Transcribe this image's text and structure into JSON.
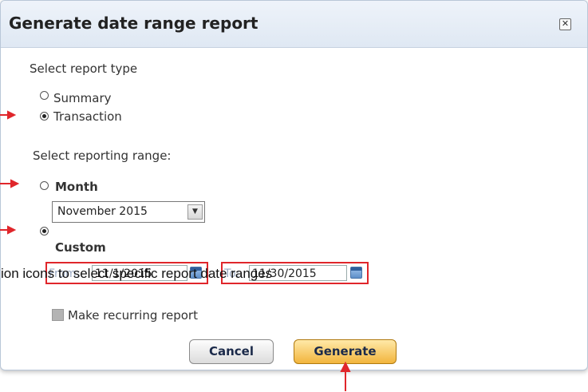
{
  "dialog": {
    "title": "Generate date range report",
    "close_icon": "close-x-icon"
  },
  "report_type": {
    "heading": "Select report type",
    "options": [
      {
        "label": "Summary",
        "checked": false
      },
      {
        "label": "Transaction",
        "checked": true
      }
    ]
  },
  "range": {
    "heading": "Select reporting range:",
    "month_label": "Month",
    "month_checked": false,
    "month_value": "November 2015",
    "custom_label": "Custom",
    "custom_checked": true,
    "from_prefix": "From:",
    "from_value": "11/1/2015",
    "to_prefix": "To:",
    "to_value": "11/30/2015"
  },
  "annotation": {
    "text": "ion icons to select specific report date ranges",
    "color": "#e0262b"
  },
  "recurring": {
    "label": "Make recurring report",
    "checked": false
  },
  "buttons": {
    "cancel": "Cancel",
    "generate": "Generate"
  },
  "colors": {
    "titlebar": "#dfe8f3",
    "highlight": "#e0262b",
    "generate_button": "#f2b53d"
  }
}
